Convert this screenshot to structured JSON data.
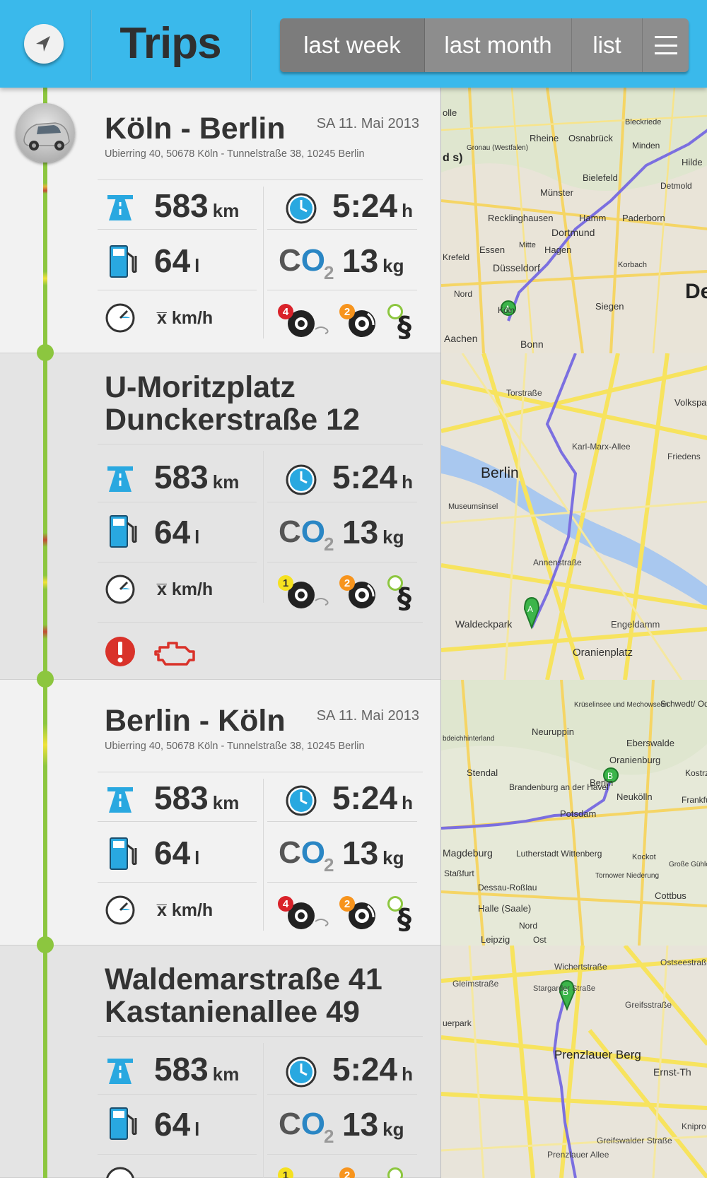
{
  "header": {
    "title": "Trips",
    "tabs": [
      {
        "label": "last week",
        "active": true
      },
      {
        "label": "last month",
        "active": false
      },
      {
        "label": "list",
        "active": false
      }
    ],
    "colors": {
      "bar": "#3ab9eb",
      "segment": "#8d8d8d"
    }
  },
  "trips": [
    {
      "title": "Köln - Berlin",
      "date": "SA 11. Mai 2013",
      "subtitle": "Ubierring 40, 50678 Köln - Tunnelstraße 38, 10245 Berlin",
      "distance": "583",
      "distance_unit": "km",
      "duration": "5:24",
      "duration_unit": "h",
      "fuel": "64",
      "fuel_unit": "l",
      "co2": "13",
      "co2_unit": "kg",
      "speed": "x̅ km/h",
      "badges": {
        "tire": "4",
        "brake": "2",
        "rule": "0"
      },
      "map": {
        "labels": [
          "Rheine",
          "Osnabrück",
          "Minden",
          "Bielefeld",
          "Münster",
          "Detmold",
          "Recklinghausen",
          "Hamm",
          "Paderborn",
          "Dortmund",
          "Essen",
          "Hagen",
          "Düsseldorf",
          "Korbach",
          "Krefeld",
          "Köln",
          "Siegen",
          "Aachen",
          "Bonn",
          "Mitte",
          "Nord",
          "Gronau (Westfalen)",
          "Hilde",
          "Bleckriede",
          "De",
          "d s)",
          "olle"
        ]
      }
    },
    {
      "title_line1": "U-Moritzplatz",
      "title_line2": "Dunckerstraße 12",
      "distance": "583",
      "distance_unit": "km",
      "duration": "5:24",
      "duration_unit": "h",
      "fuel": "64",
      "fuel_unit": "l",
      "co2": "13",
      "co2_unit": "kg",
      "speed": "x̅ km/h",
      "badges": {
        "tire": "1",
        "brake": "2",
        "rule": "0"
      },
      "alerts": [
        "warning-icon",
        "engine-icon"
      ],
      "map": {
        "labels": [
          "Torstraße",
          "Berlin",
          "Museumsinsel",
          "Karl-Marx-Allee",
          "Annenstraße",
          "Waldeckpark",
          "Engeldamm",
          "Oranienplatz",
          "Volkspar Friedrichsh",
          "Friedens"
        ]
      }
    },
    {
      "title": "Berlin - Köln",
      "date": "SA 11. Mai 2013",
      "subtitle": "Ubierring 40, 50678 Köln - Tunnelstraße 38, 10245 Berlin",
      "distance": "583",
      "distance_unit": "km",
      "duration": "5:24",
      "duration_unit": "h",
      "fuel": "64",
      "fuel_unit": "l",
      "co2": "13",
      "co2_unit": "kg",
      "speed": "x̅ km/h",
      "badges": {
        "tire": "4",
        "brake": "2",
        "rule": "0"
      },
      "map": {
        "labels": [
          "Krüselinsee und Mechowseen",
          "Schwedt/ Oder",
          "Neuruppin",
          "Eberswalde",
          "Oranienburg",
          "Brandenburg an der Havel",
          "Berlin",
          "Neukölln",
          "Stendal",
          "Potsdam",
          "Frankfu (Oder)",
          "Magdeburg",
          "Lutherstadt Wittenberg",
          "Staßfurt",
          "Dessau-Roßlau",
          "Kockot",
          "Tornower Niederung",
          "Große Gühle und Fichtenge",
          "Cottbus",
          "Halle (Saale)",
          "Nord",
          "Leipzig",
          "Ost",
          "bdeichhinterland",
          "Kostrz"
        ]
      }
    },
    {
      "title_line1": "Waldemarstraße 41",
      "title_line2": "Kastanienallee 49",
      "distance": "583",
      "distance_unit": "km",
      "duration": "5:24",
      "duration_unit": "h",
      "fuel": "64",
      "fuel_unit": "l",
      "co2": "13",
      "co2_unit": "kg",
      "badges": {
        "tire": "1",
        "brake": "2",
        "rule": "0"
      },
      "map": {
        "labels": [
          "Gleimstraße",
          "Wichertstraße",
          "Ostseestraße",
          "uerpark",
          "Stargarder Straße",
          "Greifsstraße",
          "Prenzlauer Berg",
          "Ernst-Th",
          "Greifswalder Straße",
          "Prenzlauer Allee",
          "Knipro"
        ]
      }
    }
  ]
}
